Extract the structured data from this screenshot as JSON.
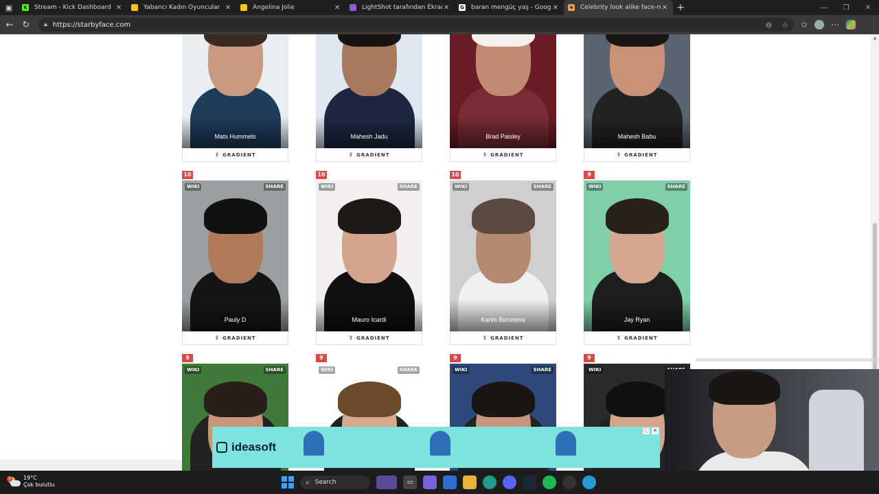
{
  "browser": {
    "tabs": [
      {
        "title": "Stream - Kick Dashboard",
        "fav_color": "#53fc18",
        "fav_char": "K",
        "active": false
      },
      {
        "title": "Yabancı Kadın Oyuncular",
        "fav_color": "#f5c518",
        "fav_char": "",
        "active": false
      },
      {
        "title": "Angelina Jolie",
        "fav_color": "#f5c518",
        "fav_char": "",
        "active": false
      },
      {
        "title": "LightShot tarafından Ekran Görü",
        "fav_color": "#8e5bd6",
        "fav_char": "",
        "active": false
      },
      {
        "title": "baran mengüç yaş - Google'da A",
        "fav_color": "#ffffff",
        "fav_char": "G",
        "active": false
      },
      {
        "title": "Celebrity look alike face-recognit",
        "fav_color": "#e8a04c",
        "fav_char": "★",
        "active": true
      }
    ],
    "url": "https://starbyface.com"
  },
  "cards": {
    "button_label": "GRADIENT",
    "wiki_label": "WIKI",
    "share_label": "SHARE",
    "row1": [
      {
        "name": "Mats Hummels",
        "bg": "#e8eef2",
        "skin": "#c99a80",
        "hair": "#3b2a22",
        "body": "#1f3c5a"
      },
      {
        "name": "Mahesh Jadu",
        "bg": "#dfe7f1",
        "skin": "#a8785f",
        "hair": "#181412",
        "body": "#1d2840"
      },
      {
        "name": "Brad Paisley",
        "bg": "#6a1b23",
        "skin": "#c08b72",
        "hair": "#f4f1ec",
        "body": "#7a2b35"
      },
      {
        "name": "Mahesh Babu",
        "bg": "#5a6470",
        "skin": "#c89276",
        "hair": "#1b1614",
        "body": "#222"
      }
    ],
    "row2": [
      {
        "name": "Pauly D",
        "badge": "10",
        "bg": "#9aa0a2",
        "skin": "#b07a58",
        "hair": "#111",
        "body": "#151515"
      },
      {
        "name": "Mauro Icardi",
        "badge": "10",
        "bg": "#f2efee",
        "skin": "#d2a58c",
        "hair": "#1f1915",
        "body": "#111"
      },
      {
        "name": "Karim Benzema",
        "badge": "10",
        "bg": "#cfcfcf",
        "skin": "#b38a70",
        "hair": "#5a4a40",
        "body": "#f0f0f0"
      },
      {
        "name": "Jay Ryan",
        "badge": "9 %",
        "bg": "#7fd0a8",
        "skin": "#d4a78e",
        "hair": "#2a211b",
        "body": "#1e1e1e"
      }
    ],
    "row3": [
      {
        "badge": "9 %",
        "bg": "#3f7a3a",
        "skin": "#c7957a",
        "hair": "#2a1f18"
      },
      {
        "badge": "9 %",
        "bg": "#ffffff",
        "skin": "#d6a98c",
        "hair": "#6b4a2a"
      },
      {
        "badge": "9 %",
        "bg": "#2f4a7a",
        "skin": "#c9967c",
        "hair": "#1b1614"
      },
      {
        "badge": "9 %",
        "bg": "#2b2b2b",
        "skin": "#d3a58b",
        "hair": "#111"
      }
    ]
  },
  "ad": {
    "brand": "ideasoft",
    "bg": "#7fe3dd"
  },
  "stream": {
    "label": "",
    "time": ""
  },
  "taskbar": {
    "weather_temp": "19°C",
    "weather_desc": "Çok bulutlu",
    "weather_badge": "5",
    "search_placeholder": "Search"
  }
}
